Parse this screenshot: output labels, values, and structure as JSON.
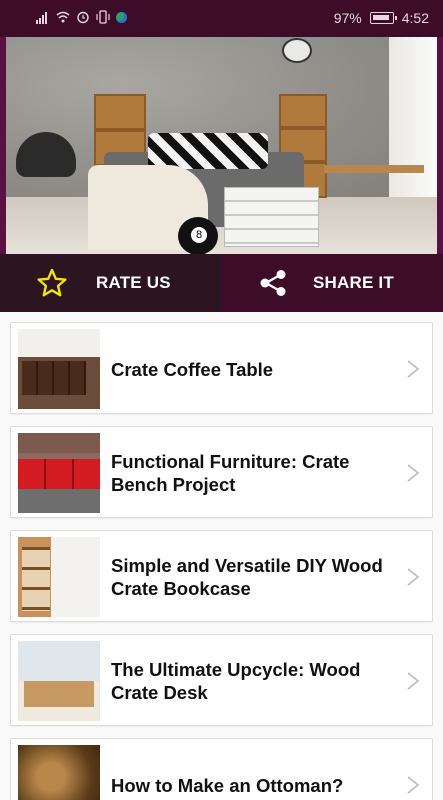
{
  "status_bar": {
    "battery_percent": "97%",
    "time": "4:52",
    "icons": [
      "signal-icon",
      "wifi-icon",
      "alarm-icon",
      "vibrate-icon",
      "app-notification-icon",
      "battery-icon"
    ]
  },
  "hero": {
    "image": "bedroom-with-wood-crate-furniture"
  },
  "actions": {
    "rate": {
      "label": "RATE US",
      "icon": "star-icon"
    },
    "share": {
      "label": "SHARE IT",
      "icon": "share-icon"
    }
  },
  "articles": [
    {
      "title": "Crate Coffee Table",
      "thumb": "crate-coffee-table-thumb"
    },
    {
      "title": "Functional Furniture: Crate Bench Project",
      "thumb": "crate-bench-thumb"
    },
    {
      "title": "Simple and Versatile DIY Wood Crate Bookcase",
      "thumb": "crate-bookcase-thumb"
    },
    {
      "title": "The Ultimate Upcycle: Wood Crate Desk",
      "thumb": "crate-desk-thumb"
    },
    {
      "title": "How to Make an Ottoman?",
      "thumb": "ottoman-thumb"
    }
  ],
  "colors": {
    "status_bar": "#3d0c29",
    "rate_button": "#2a1521",
    "share_button": "#3d0c29",
    "star": "#f4e400"
  }
}
